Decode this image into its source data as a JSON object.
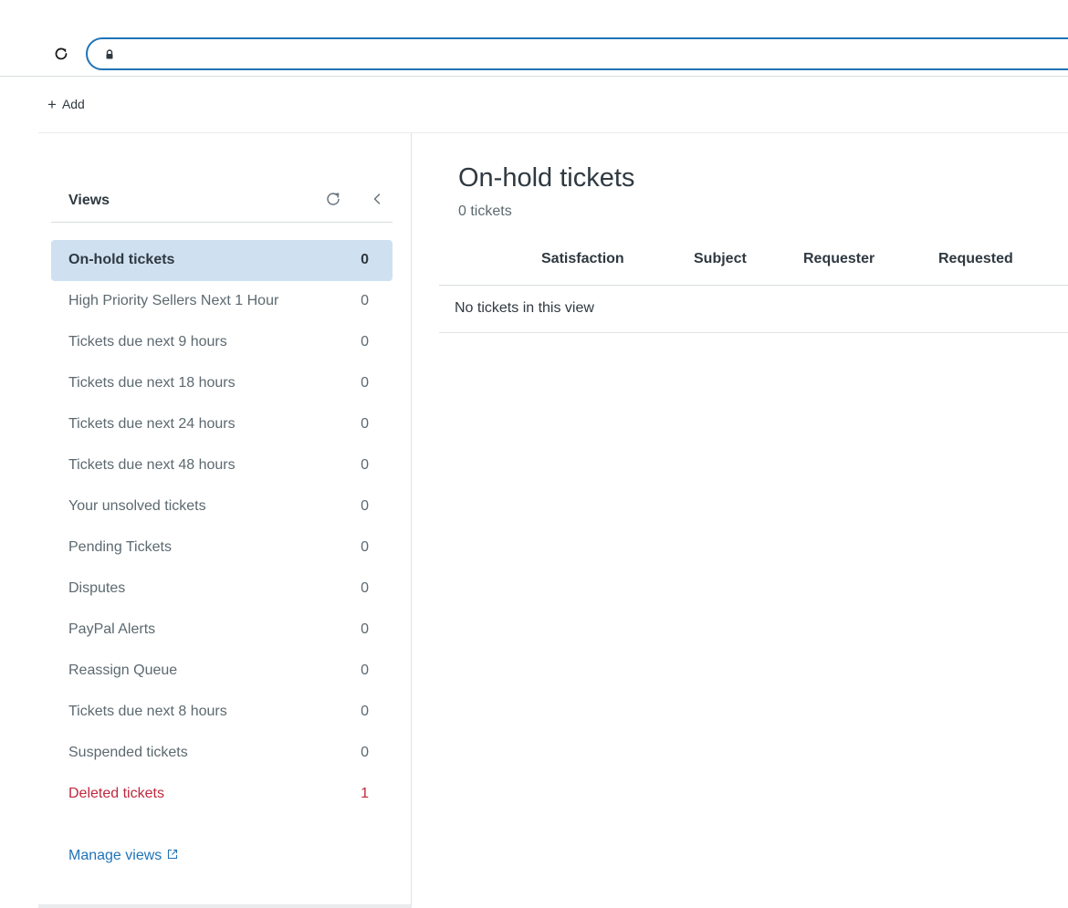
{
  "browser": {
    "reload_icon": "reload-icon",
    "lock_icon": "lock-icon",
    "url": ""
  },
  "toolbar": {
    "add_label": "Add"
  },
  "views": {
    "title": "Views",
    "items": [
      {
        "label": "On-hold tickets",
        "count": "0",
        "state": "active"
      },
      {
        "label": "High Priority Sellers Next 1 Hour",
        "count": "0",
        "state": "normal"
      },
      {
        "label": "Tickets due next 9 hours",
        "count": "0",
        "state": "normal"
      },
      {
        "label": "Tickets due next 18 hours",
        "count": "0",
        "state": "normal"
      },
      {
        "label": "Tickets due next 24 hours",
        "count": "0",
        "state": "normal"
      },
      {
        "label": "Tickets due next 48 hours",
        "count": "0",
        "state": "normal"
      },
      {
        "label": "Your unsolved tickets",
        "count": "0",
        "state": "normal"
      },
      {
        "label": "Pending Tickets",
        "count": "0",
        "state": "normal"
      },
      {
        "label": "Disputes",
        "count": "0",
        "state": "normal"
      },
      {
        "label": "PayPal Alerts",
        "count": "0",
        "state": "normal"
      },
      {
        "label": "Reassign Queue",
        "count": "0",
        "state": "normal"
      },
      {
        "label": "Tickets due next 8 hours",
        "count": "0",
        "state": "normal"
      },
      {
        "label": "Suspended tickets",
        "count": "0",
        "state": "normal"
      },
      {
        "label": "Deleted tickets",
        "count": "1",
        "state": "danger"
      }
    ],
    "manage_label": "Manage views"
  },
  "main": {
    "title": "On-hold tickets",
    "ticket_count": "0 tickets",
    "columns": [
      "Satisfaction",
      "Subject",
      "Requester",
      "Requested"
    ],
    "empty_message": "No tickets in this view"
  },
  "colors": {
    "accent": "#1f73b7",
    "active_bg": "#cfe0f1",
    "danger": "#c0283c",
    "muted_text": "#5c6970"
  }
}
